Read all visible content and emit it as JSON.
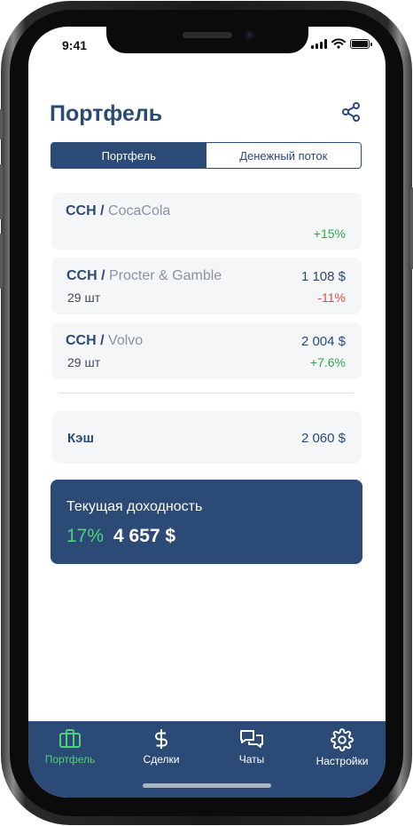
{
  "status_bar": {
    "time": "9:41"
  },
  "header": {
    "title": "Портфель",
    "share_icon": "share-icon"
  },
  "segmented": {
    "tabs": [
      {
        "label": "Портфель",
        "active": true
      },
      {
        "label": "Денежный поток",
        "active": false
      }
    ]
  },
  "holdings": [
    {
      "ticker": "CCH",
      "separator": "/",
      "company": "CocaCola",
      "quantity": "",
      "amount": "",
      "change": "+15%"
    },
    {
      "ticker": "CCH",
      "separator": "/",
      "company": "Procter & Gamble",
      "quantity": "29 шт",
      "amount": "1 108 $",
      "change": "-11%"
    },
    {
      "ticker": "CCH",
      "separator": "/",
      "company": "Volvo",
      "quantity": "29 шт",
      "amount": "2 004 $",
      "change": "+7.6%"
    }
  ],
  "cash": {
    "label": "Кэш",
    "value": "2 060 $"
  },
  "current_yield": {
    "label": "Текущая доходность",
    "percent": "17%",
    "amount": "4 657 $"
  },
  "tabbar": {
    "items": [
      {
        "label": "Портфель",
        "icon": "briefcase-icon",
        "active": true
      },
      {
        "label": "Сделки",
        "icon": "dollar-icon",
        "active": false
      },
      {
        "label": "Чаты",
        "icon": "chat-icon",
        "active": false
      },
      {
        "label": "Настройки",
        "icon": "gear-icon",
        "active": false
      }
    ]
  },
  "colors": {
    "primary": "#2b4a75",
    "positive": "#2fa84f",
    "negative": "#e04a4a",
    "active_tab": "#4fd27a",
    "card_bg": "#f5f6f8"
  }
}
